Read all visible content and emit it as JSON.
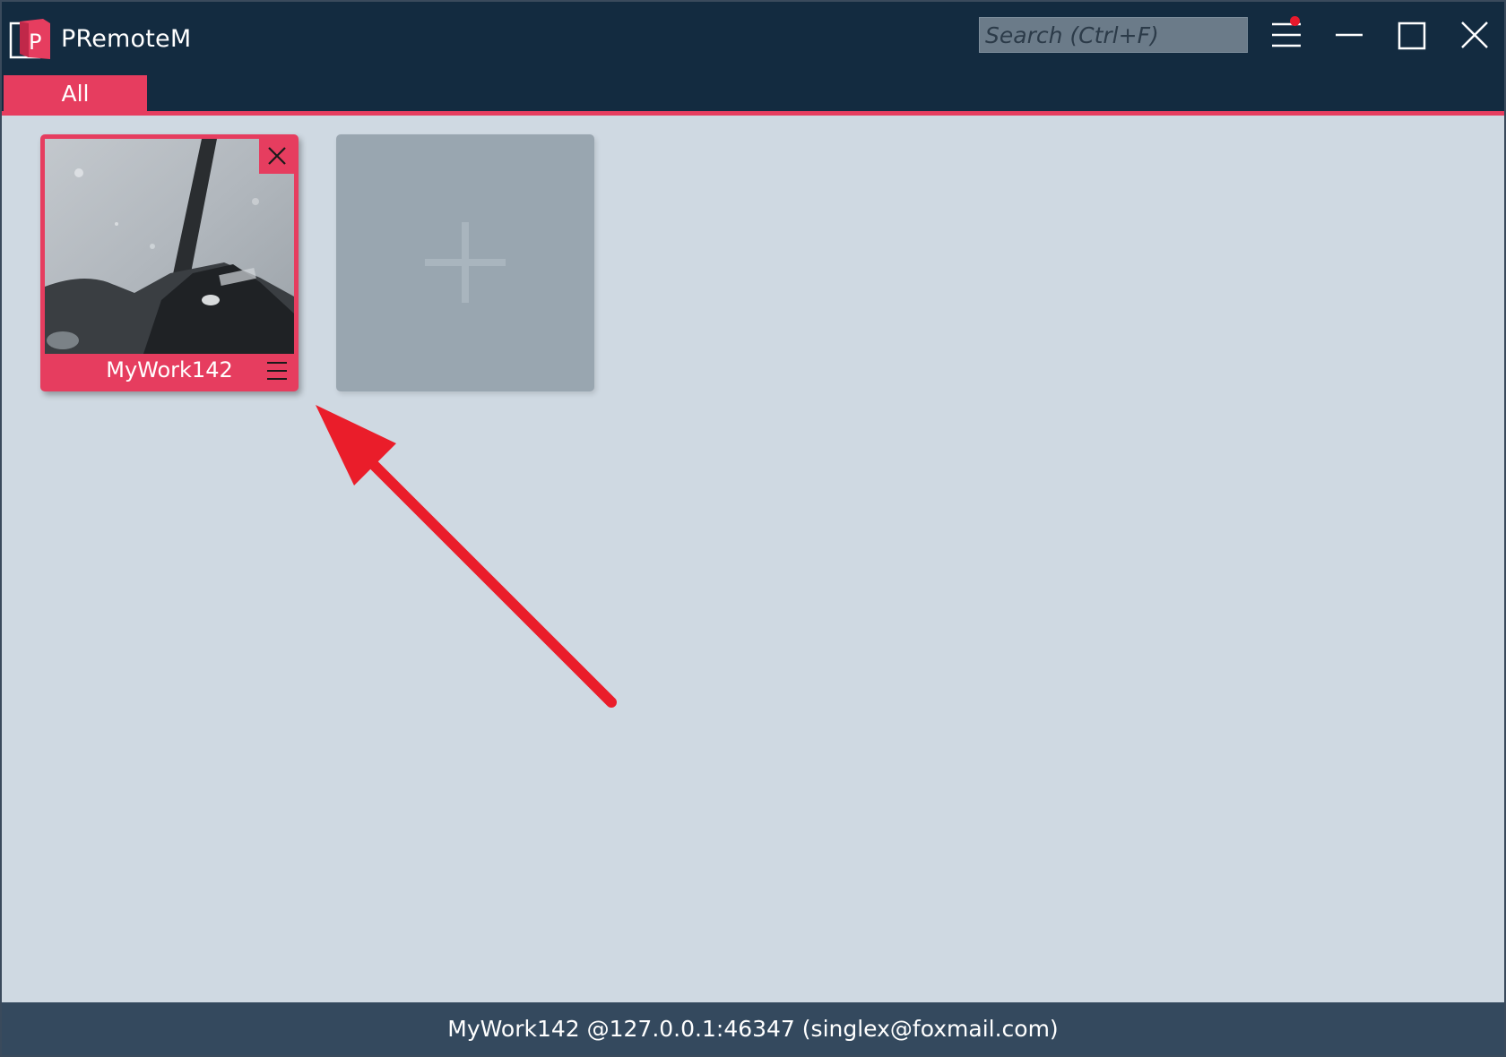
{
  "app": {
    "title": "PRemoteM",
    "logo_letter": "P"
  },
  "search": {
    "placeholder": "Search (Ctrl+F)"
  },
  "titlebar": {
    "menu_icon": "hamburger-menu-icon",
    "notification_dot": true,
    "minimize_icon": "minimize-icon",
    "maximize_icon": "maximize-icon",
    "close_icon": "close-icon"
  },
  "tabs": [
    {
      "label": "All",
      "selected": true
    }
  ],
  "servers": [
    {
      "name": "MyWork142",
      "close_label": "X"
    }
  ],
  "add_tile": {
    "icon": "plus-icon"
  },
  "status": {
    "text": "MyWork142  @127.0.0.1:46347 (singlex@foxmail.com)"
  },
  "colors": {
    "accent": "#e63d5f",
    "titlebar": "#132b40",
    "content_bg": "#cfd9e2",
    "statusbar": "#34495e",
    "add_tile": "#99a6b0",
    "annotation_arrow": "#ea1d2a"
  }
}
